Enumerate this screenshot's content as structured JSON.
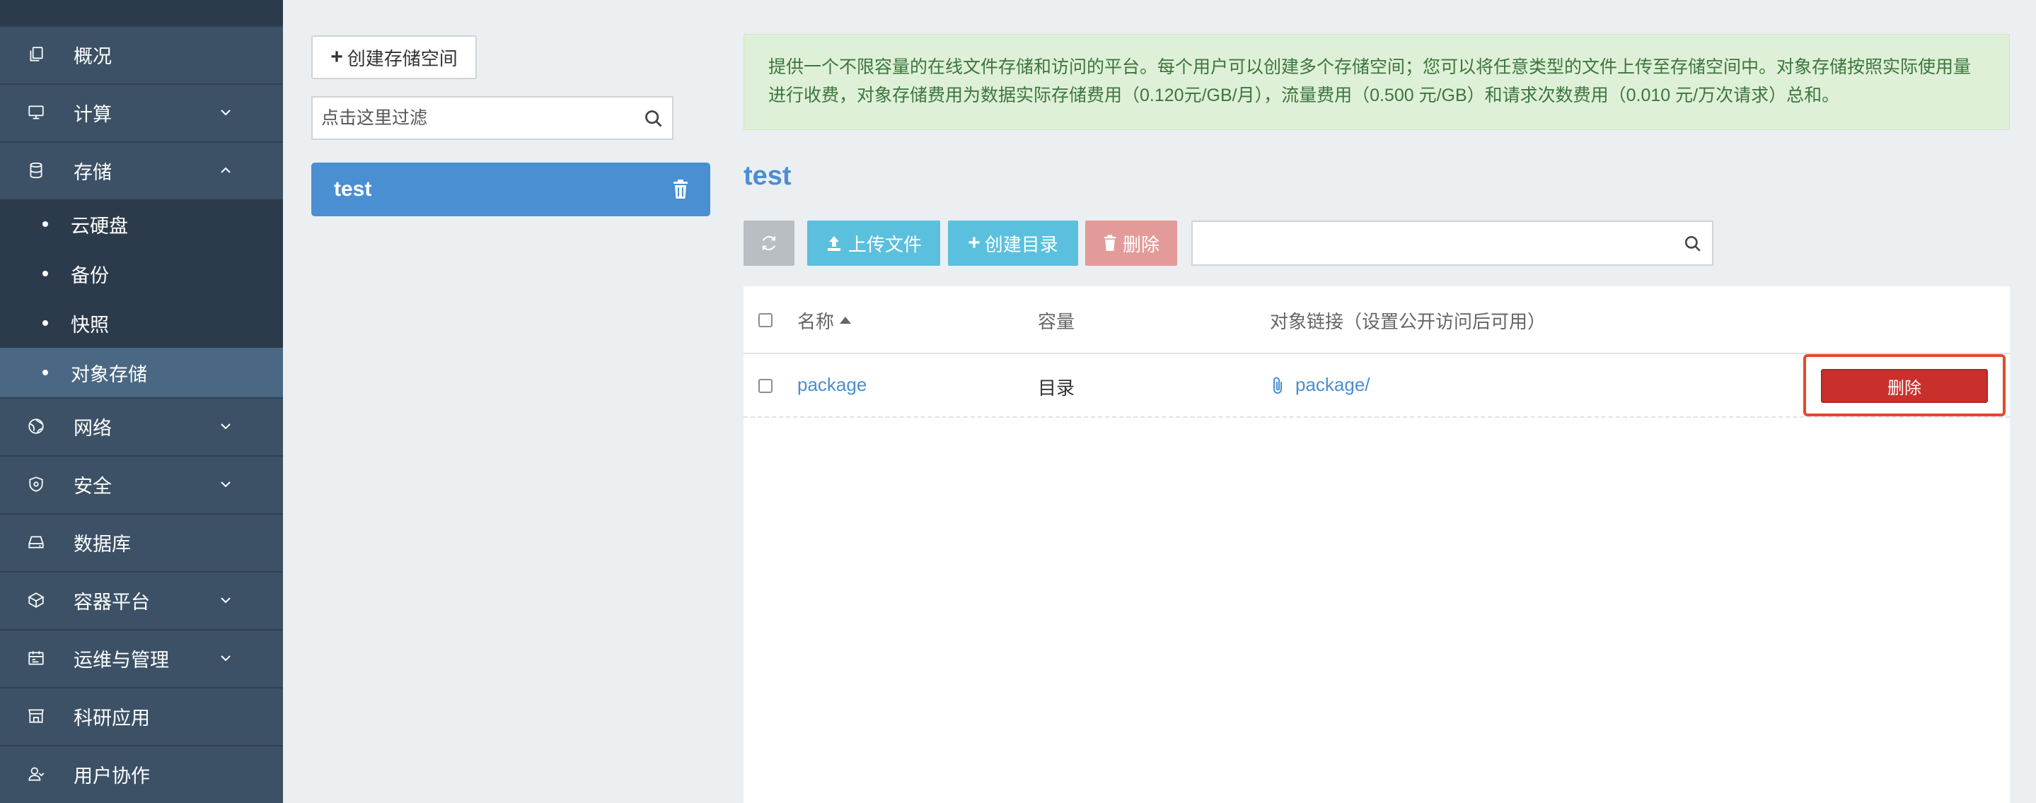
{
  "sidebar": {
    "items": [
      {
        "label": "概况",
        "icon": "copy-icon",
        "has_chevron": false
      },
      {
        "label": "计算",
        "icon": "monitor-icon",
        "has_chevron": true,
        "chevron": "down"
      },
      {
        "label": "存储",
        "icon": "database-icon",
        "has_chevron": true,
        "chevron": "up",
        "expanded": true
      },
      {
        "label": "网络",
        "icon": "globe-icon",
        "has_chevron": true,
        "chevron": "down"
      },
      {
        "label": "安全",
        "icon": "shield-icon",
        "has_chevron": true,
        "chevron": "down"
      },
      {
        "label": "数据库",
        "icon": "hard-drive-icon",
        "has_chevron": false
      },
      {
        "label": "容器平台",
        "icon": "cube-icon",
        "has_chevron": true,
        "chevron": "down"
      },
      {
        "label": "运维与管理",
        "icon": "calendar-icon",
        "has_chevron": true,
        "chevron": "down"
      },
      {
        "label": "科研应用",
        "icon": "store-icon",
        "has_chevron": false
      },
      {
        "label": "用户协作",
        "icon": "users-icon",
        "has_chevron": false
      }
    ],
    "storage_sub": [
      {
        "label": "云硬盘",
        "active": false
      },
      {
        "label": "备份",
        "active": false
      },
      {
        "label": "快照",
        "active": false
      },
      {
        "label": "对象存储",
        "active": true
      }
    ]
  },
  "left_panel": {
    "create_bucket_label": "创建存储空间",
    "filter_placeholder": "点击这里过滤",
    "buckets": [
      {
        "name": "test",
        "selected": true
      }
    ]
  },
  "main": {
    "info_text": "提供一个不限容量的在线文件存储和访问的平台。每个用户可以创建多个存储空间；您可以将任意类型的文件上传至存储空间中。对象存储按照实际使用量进行收费，对象存储费用为数据实际存储费用（0.120元/GB/月），流量费用（0.500 元/GB）和请求次数费用（0.010 元/万次请求）总和。",
    "bucket_title": "test",
    "toolbar": {
      "upload_label": "上传文件",
      "mkdir_label": "创建目录",
      "delete_label": "删除",
      "search_value": ""
    },
    "table": {
      "headers": {
        "name": "名称",
        "capacity": "容量",
        "link": "对象链接（设置公开访问后可用）"
      },
      "rows": [
        {
          "name": "package",
          "capacity": "目录",
          "link": "package/",
          "action": "删除"
        }
      ]
    }
  },
  "colors": {
    "sidebar_bg": "#3c5166",
    "sidebar_sub_bg": "#2c3b4b",
    "sidebar_active": "#4a6883",
    "accent_blue": "#4a8fd1",
    "info_btn": "#5bc0de",
    "danger": "#c9302c",
    "highlight_outline": "#e8472b",
    "success_bg": "#dff0d8",
    "success_text": "#3c763d"
  }
}
